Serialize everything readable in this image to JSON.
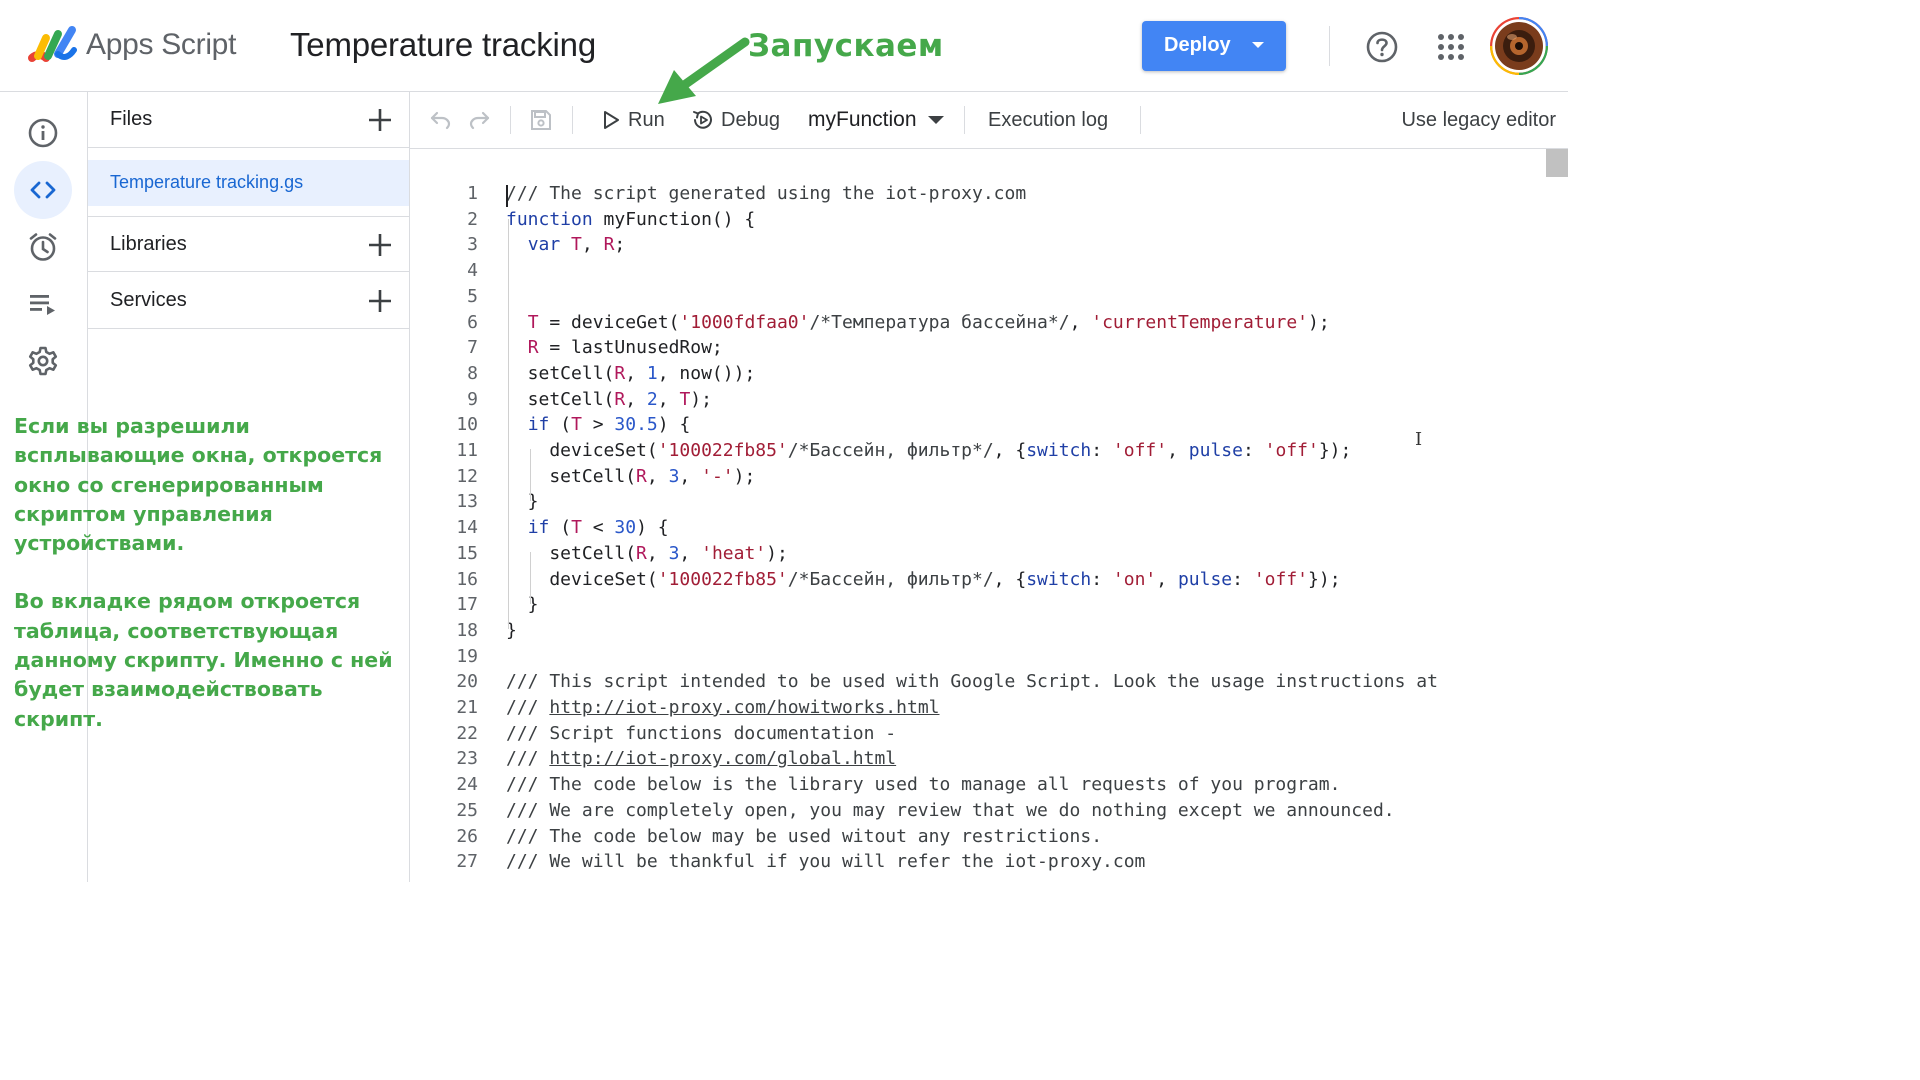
{
  "header": {
    "app_name": "Apps Script",
    "project_title": "Temperature tracking",
    "deploy_label": "Deploy",
    "icons": [
      "apps-script-logo",
      "help-icon",
      "apps-grid-icon",
      "avatar"
    ]
  },
  "rail": {
    "items": [
      {
        "name": "overview",
        "icon": "info-icon",
        "active": false
      },
      {
        "name": "editor",
        "icon": "code-icon",
        "active": true
      },
      {
        "name": "triggers",
        "icon": "alarm-icon",
        "active": false
      },
      {
        "name": "executions",
        "icon": "executions-icon",
        "active": false
      },
      {
        "name": "settings",
        "icon": "gear-icon",
        "active": false
      }
    ]
  },
  "files_panel": {
    "files_title": "Files",
    "file_name": "Temperature tracking.gs",
    "libraries_title": "Libraries",
    "services_title": "Services"
  },
  "toolbar": {
    "run_label": "Run",
    "debug_label": "Debug",
    "function_name": "myFunction",
    "execution_log_label": "Execution log",
    "legacy_label": "Use legacy editor"
  },
  "editor": {
    "line_numbers": [
      "1",
      "2",
      "3",
      "4",
      "5",
      "6",
      "7",
      "8",
      "9",
      "10",
      "11",
      "12",
      "13",
      "14",
      "15",
      "16",
      "17",
      "18",
      "19",
      "20",
      "21",
      "22",
      "23",
      "24",
      "25",
      "26",
      "27"
    ],
    "lines": [
      "/// The script generated using the iot-proxy.com",
      "function myFunction() {",
      "  var T, R;",
      "",
      "",
      "  T = deviceGet('1000fdfaa0'/*Температура бассейна*/, 'currentTemperature');",
      "  R = lastUnusedRow;",
      "  setCell(R, 1, now());",
      "  setCell(R, 2, T);",
      "  if (T > 30.5) {",
      "    deviceSet('100022fb85'/*Бассейн, фильтр*/, {switch: 'off', pulse: 'off'});",
      "    setCell(R, 3, '-');",
      "  }",
      "  if (T < 30) {",
      "    setCell(R, 3, 'heat');",
      "    deviceSet('100022fb85'/*Бассейн, фильтр*/, {switch: 'on', pulse: 'off'});",
      "  }",
      "}",
      "",
      "/// This script intended to be used with Google Script. Look the usage instructions at",
      "/// http://iot-proxy.com/howitworks.html",
      "/// Script functions documentation -",
      "/// http://iot-proxy.com/global.html",
      "/// The code below is the library used to manage all requests of you program.",
      "/// We are completely open, you may review that we do nothing except we announced.",
      "/// The code below may be used witout any restrictions.",
      "/// We will be thankful if you will refer the iot-proxy.com"
    ]
  },
  "annotations": {
    "run_hint": "Запускаем",
    "paragraph1": "Если вы разрешили всплывающие окна, откроется окно со сгенерированным скриптом управления устройствами.",
    "paragraph2": "Во вкладке рядом откроется таблица, соответствующая данному скрипту. Именно с ней будет взаимодействовать скрипт."
  },
  "colors": {
    "accent": "#4285f4",
    "annotation_green": "#45a84a",
    "active_bg": "#e8f0fe",
    "active_text": "#1967d2"
  }
}
